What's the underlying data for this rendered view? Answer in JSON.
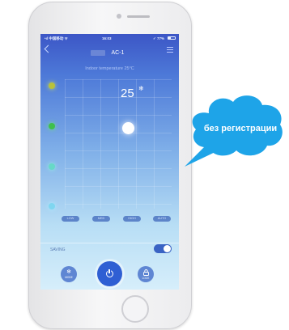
{
  "status_bar": {
    "carrier": "•ıl 中国移动 ᯤ",
    "time": "16:03",
    "battery": "✓ 77%"
  },
  "nav": {
    "title": "AC-1"
  },
  "main": {
    "indoor_label": "Indoor temperature 25°C",
    "set_temperature": "25",
    "mode_symbol": "❄",
    "fan_speeds": [
      "LOW",
      "MED",
      "HIGH",
      "AUTO"
    ]
  },
  "saving": {
    "label": "SAVING",
    "enabled": true
  },
  "bottom_buttons": {
    "mode_label": "MODE",
    "lock_label": "LOCK"
  },
  "bubble": {
    "text": "без регистрации"
  },
  "colors": {
    "accent": "#2f5fd3",
    "bubble": "#1ea4e8"
  },
  "icons": [
    "back-icon",
    "menu-icon",
    "snowflake-icon",
    "power-icon",
    "lock-icon"
  ]
}
